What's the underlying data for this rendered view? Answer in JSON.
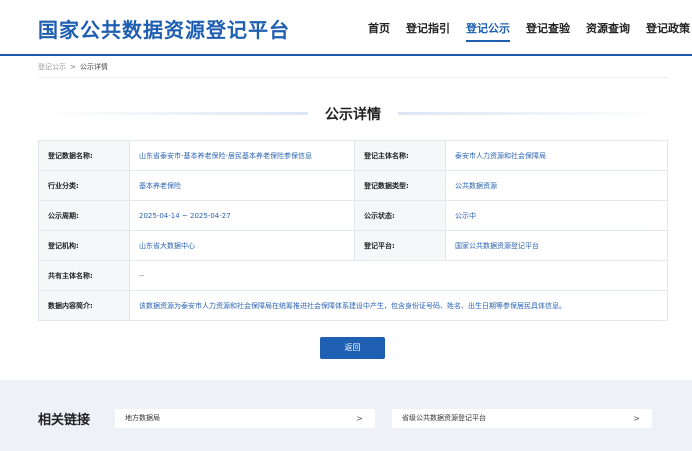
{
  "header": {
    "site_title": "国家公共数据资源登记平台",
    "nav": [
      {
        "label": "首页",
        "active": false
      },
      {
        "label": "登记指引",
        "active": false
      },
      {
        "label": "登记公示",
        "active": true
      },
      {
        "label": "登记查验",
        "active": false
      },
      {
        "label": "资源查询",
        "active": false
      },
      {
        "label": "登记政策",
        "active": false
      }
    ]
  },
  "breadcrumb": {
    "parent": "登记公示",
    "separator": ">",
    "current": "公示详情"
  },
  "detail": {
    "heading": "公示详情",
    "rows": [
      {
        "label1": "登记数据名称:",
        "value1": "山东省泰安市-基本养老保险-居民基本养老保险参保信息",
        "label2": "登记主体名称:",
        "value2": "泰安市人力资源和社会保障局"
      },
      {
        "label1": "行业分类:",
        "value1": "基本养老保险",
        "label2": "登记数据类型:",
        "value2": "公共数据资源"
      },
      {
        "label1": "公示周期:",
        "value1": "2025-04-14 ~ 2025-04-27",
        "label2": "公示状态:",
        "value2": "公示中"
      },
      {
        "label1": "登记机构:",
        "value1": "山东省大数据中心",
        "label2": "登记平台:",
        "value2": "国家公共数据资源登记平台"
      }
    ],
    "co_owner": {
      "label": "共有主体名称:",
      "value": "--"
    },
    "summary": {
      "label": "数据内容简介:",
      "value": "该数据资源为泰安市人力资源和社会保障局在统筹推进社会保障体系建设中产生，包含身份证号码、姓名、出生日期等参保居民具体信息。"
    }
  },
  "back_button": "返回",
  "related": {
    "title": "相关链接",
    "links": [
      {
        "label": "地方数据局",
        "arrow": ">"
      },
      {
        "label": "省级公共数据资源登记平台",
        "arrow": ">"
      }
    ]
  },
  "colors": {
    "brand_blue": "#1f5fb1",
    "value_blue": "#2a63b4",
    "related_bg": "#eef2f8"
  }
}
